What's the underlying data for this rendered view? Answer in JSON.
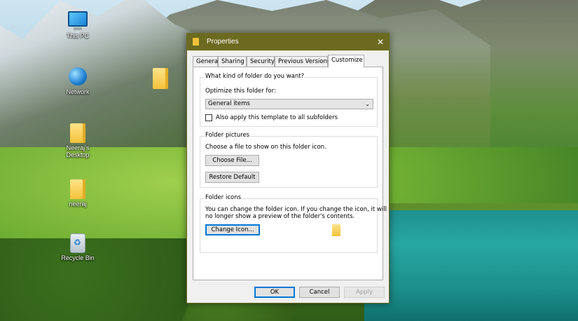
{
  "desktop": {
    "icons": [
      {
        "label": "This PC",
        "icon": "computer-icon"
      },
      {
        "label": "Network",
        "icon": "network-icon"
      },
      {
        "label": "Neeraj's Desktop",
        "icon": "folder-icon"
      },
      {
        "label": "neeraj",
        "icon": "user-folder-icon"
      },
      {
        "label": "Recycle Bin",
        "icon": "recycle-bin-icon"
      }
    ]
  },
  "dialog": {
    "title": "Properties",
    "close_glyph": "✕",
    "tabs": [
      "General",
      "Sharing",
      "Security",
      "Previous Versions",
      "Customize"
    ],
    "active_tab": "Customize",
    "folder_type": {
      "legend": "What kind of folder do you want?",
      "optimize_label": "Optimize this folder for:",
      "selected_option": "General items",
      "apply_subfolders_label": "Also apply this template to all subfolders",
      "apply_subfolders_checked": false
    },
    "folder_pictures": {
      "legend": "Folder pictures",
      "description": "Choose a file to show on this folder icon.",
      "choose_file_label": "Choose File...",
      "restore_default_label": "Restore Default"
    },
    "folder_icons": {
      "legend": "Folder icons",
      "description_line1": "You can change the folder icon. If you change the icon, it will",
      "description_line2": "no longer show a preview of the folder's contents.",
      "change_icon_label": "Change Icon..."
    },
    "buttons": {
      "ok": "OK",
      "cancel": "Cancel",
      "apply": "Apply"
    }
  }
}
